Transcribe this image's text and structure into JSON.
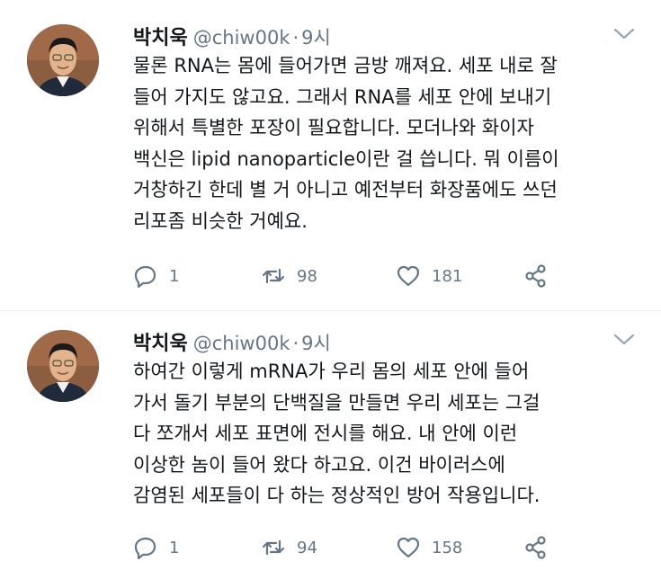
{
  "tweets": [
    {
      "name": "박치욱",
      "handle": "@chiw00k",
      "dot": "·",
      "time": "9시",
      "text": "물론 RNA는 몸에 들어가면 금방 깨져요. 세포 내로 잘\n들어 가지도 않고요. 그래서 RNA를 세포 안에 보내기\n위해서 특별한 포장이 필요합니다. 모더나와 화이자\n백신은 lipid nanoparticle이란 걸 씁니다. 뭐 이름이\n거창하긴 한데 별 거 아니고 예전부터 화장품에도 쓰던\n리포좀 비슷한 거예요.",
      "replies": "1",
      "retweets": "98",
      "likes": "181"
    },
    {
      "name": "박치욱",
      "handle": "@chiw00k",
      "dot": "·",
      "time": "9시",
      "text": "하여간 이렇게 mRNA가 우리 몸의 세포 안에 들어\n가서 돌기 부분의 단백질을 만들면 우리 세포는 그걸\n다 쪼개서 세포 표면에 전시를 해요. 내 안에 이런\n이상한 놈이 들어 왔다 하고요. 이건 바이러스에\n감염된 세포들이 다 하는 정상적인 방어 작용입니다.",
      "replies": "1",
      "retweets": "94",
      "likes": "158"
    }
  ],
  "icons": {
    "reply": "reply-icon",
    "retweet": "retweet-icon",
    "like": "heart-icon",
    "share": "share-icon",
    "menu": "chevron-down-icon"
  },
  "colors": {
    "text": "#14171a",
    "secondary": "#657786",
    "divider": "#e6ecf0"
  }
}
